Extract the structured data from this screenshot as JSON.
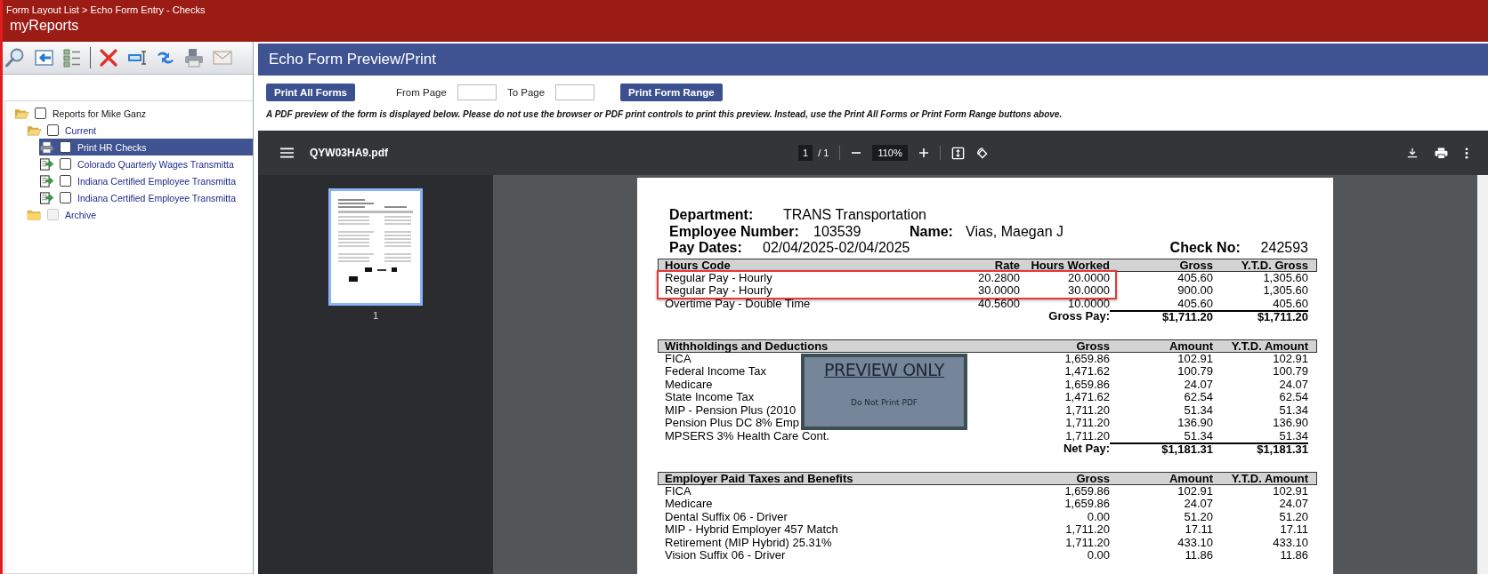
{
  "header": {
    "breadcrumb": "Form Layout List > Echo Form Entry - Checks",
    "app_title": "myReports"
  },
  "tree": [
    {
      "label": "Reports for Mike Ganz",
      "kind": "folder",
      "expanded": true,
      "checked": false,
      "disabled": false,
      "selected": false,
      "children": [
        {
          "label": "Current",
          "kind": "folder",
          "expanded": true,
          "checked": false,
          "disabled": false,
          "selected": false,
          "children": [
            {
              "label": "Print HR Checks",
              "kind": "print",
              "checked": false,
              "disabled": false,
              "selected": true
            },
            {
              "label": "Colorado Quarterly Wages Transmitta",
              "kind": "export",
              "checked": false,
              "disabled": false,
              "selected": false
            },
            {
              "label": "Indiana Certified Employee Transmitta",
              "kind": "export",
              "checked": false,
              "disabled": false,
              "selected": false
            },
            {
              "label": "Indiana Certified Employee Transmitta",
              "kind": "export",
              "checked": false,
              "disabled": false,
              "selected": false
            }
          ]
        },
        {
          "label": "Archive",
          "kind": "folder",
          "expanded": false,
          "checked": false,
          "disabled": true,
          "selected": false
        }
      ]
    }
  ],
  "panel": {
    "title": "Echo Form Preview/Print",
    "print_all": "Print All Forms",
    "from_label": "From Page",
    "to_label": "To Page",
    "print_range": "Print Form Range",
    "note": "A PDF preview of the form is displayed below. Please do not use the browser or PDF print controls to print this preview. Instead, use the Print All Forms or Print Form Range buttons above."
  },
  "viewer": {
    "filename": "QYW03HA9.pdf",
    "page": "1",
    "page_total": "/ 1",
    "zoom": "110%",
    "thumbnails": [
      {
        "label": "1",
        "selected": true
      }
    ]
  },
  "overlay": {
    "title": "PREVIEW ONLY",
    "subtitle": "Do Not Print PDF"
  },
  "document": {
    "department": {
      "label": "Department:",
      "value": "TRANS Transportation"
    },
    "employee_number": {
      "label": "Employee Number:",
      "value": "103539"
    },
    "name": {
      "label": "Name:",
      "value": "Vias, Maegan J"
    },
    "pay_dates": {
      "label": "Pay Dates:",
      "value": "02/04/2025-02/04/2025"
    },
    "check_no": {
      "label": "Check No:",
      "value": "242593"
    },
    "sections": [
      {
        "kind": "hours",
        "columns": [
          "Hours Code",
          "Rate",
          "Hours Worked",
          "Gross",
          "Y.T.D. Gross"
        ],
        "rows": [
          {
            "cells": [
              "Regular Pay - Hourly",
              "20.2800",
              "20.0000",
              "405.60",
              "1,305.60"
            ],
            "highlighted": true
          },
          {
            "cells": [
              "Regular Pay - Hourly",
              "30.0000",
              "30.0000",
              "900.00",
              "1,305.60"
            ],
            "highlighted": true
          },
          {
            "cells": [
              "Overtime Pay - Double Time",
              "40.5600",
              "10.0000",
              "405.60",
              "405.60"
            ],
            "highlighted": false
          }
        ],
        "total": {
          "label": "Gross Pay:",
          "values": [
            "$1,711.20",
            "$1,711.20"
          ]
        }
      },
      {
        "kind": "amounts",
        "columns": [
          "Withholdings and Deductions",
          "Gross",
          "Amount",
          "Y.T.D. Amount"
        ],
        "rows": [
          {
            "cells": [
              "FICA",
              "1,659.86",
              "102.91",
              "102.91"
            ],
            "highlighted": false
          },
          {
            "cells": [
              "Federal Income Tax",
              "1,471.62",
              "100.79",
              "100.79"
            ],
            "highlighted": false
          },
          {
            "cells": [
              "Medicare",
              "1,659.86",
              "24.07",
              "24.07"
            ],
            "highlighted": false
          },
          {
            "cells": [
              "State Income Tax",
              "1,471.62",
              "62.54",
              "62.54"
            ],
            "highlighted": false
          },
          {
            "cells": [
              "MIP - Pension Plus (2010",
              "1,711.20",
              "51.34",
              "51.34"
            ],
            "highlighted": false
          },
          {
            "cells": [
              "Pension Plus DC 8% Emp",
              "1,711.20",
              "136.90",
              "136.90"
            ],
            "highlighted": false
          },
          {
            "cells": [
              "MPSERS 3% Health Care Cont.",
              "1,711.20",
              "51.34",
              "51.34"
            ],
            "highlighted": false
          }
        ],
        "total": {
          "label": "Net Pay:",
          "values": [
            "$1,181.31",
            "$1,181.31"
          ]
        }
      },
      {
        "kind": "amounts",
        "columns": [
          "Employer Paid Taxes and Benefits",
          "Gross",
          "Amount",
          "Y.T.D. Amount"
        ],
        "rows": [
          {
            "cells": [
              "FICA",
              "1,659.86",
              "102.91",
              "102.91"
            ],
            "highlighted": false
          },
          {
            "cells": [
              "Medicare",
              "1,659.86",
              "24.07",
              "24.07"
            ],
            "highlighted": false
          },
          {
            "cells": [
              "Dental Suffix 06 - Driver",
              "0.00",
              "51.20",
              "51.20"
            ],
            "highlighted": false
          },
          {
            "cells": [
              "MIP - Hybrid Employer 457 Match",
              "1,711.20",
              "17.11",
              "17.11"
            ],
            "highlighted": false
          },
          {
            "cells": [
              "Retirement (MIP Hybrid) 25.31%",
              "1,711.20",
              "433.10",
              "433.10"
            ],
            "highlighted": false
          },
          {
            "cells": [
              "Vision Suffix 06 - Driver",
              "0.00",
              "11.86",
              "11.86"
            ],
            "highlighted": false
          }
        ]
      }
    ]
  }
}
